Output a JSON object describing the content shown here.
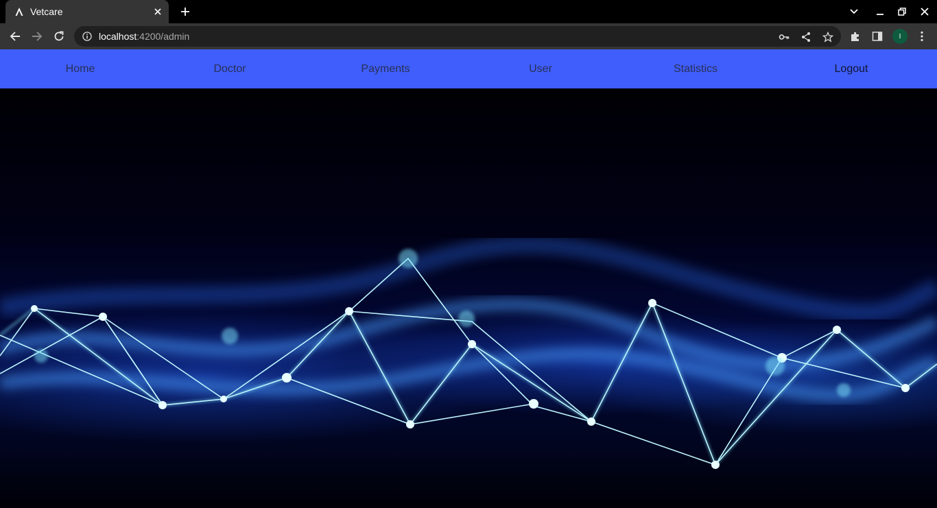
{
  "browser": {
    "tab_title": "Vetcare",
    "url_host": "localhost",
    "url_path": ":4200/admin",
    "profile_initial": "I"
  },
  "nav": {
    "items": [
      {
        "label": "Home",
        "name": "nav-home"
      },
      {
        "label": "Doctor",
        "name": "nav-doctor"
      },
      {
        "label": "Payments",
        "name": "nav-payments"
      },
      {
        "label": "User",
        "name": "nav-user"
      },
      {
        "label": "Statistics",
        "name": "nav-statistics"
      },
      {
        "label": "Logout",
        "name": "nav-logout"
      }
    ]
  },
  "colors": {
    "navbar": "#3f5efb",
    "chrome_dark": "#000000",
    "chrome_toolbar": "#353535"
  }
}
